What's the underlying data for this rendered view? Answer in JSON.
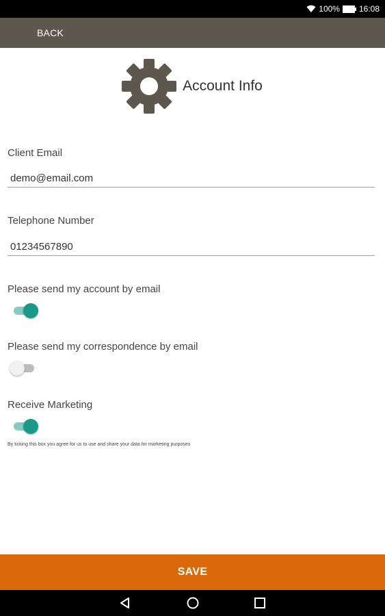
{
  "status_bar": {
    "battery_text": "100%",
    "time": "16:08",
    "icons": [
      "wifi-icon",
      "battery-icon"
    ]
  },
  "toolbar": {
    "back_label": "BACK",
    "color": "#5e574e"
  },
  "header": {
    "title": "Account Info",
    "icon": "gear-icon"
  },
  "form": {
    "email": {
      "label": "Client Email",
      "value": "demo@email.com"
    },
    "phone": {
      "label": "Telephone Number",
      "value": "01234567890"
    },
    "toggles": [
      {
        "label": "Please send my account by email",
        "checked": true
      },
      {
        "label": "Please send my correspondence by email",
        "checked": false
      },
      {
        "label": "Receive Marketing",
        "checked": true
      }
    ],
    "disclaimer": "By ticking this box you agree for us to use and share your data for marketing purposes"
  },
  "save_label": "SAVE",
  "colors": {
    "accent": "#d9690a",
    "switch_on": "#1b9a8a"
  },
  "nav_bar": {
    "icons": [
      "back-nav-icon",
      "home-nav-icon",
      "recents-nav-icon"
    ]
  }
}
